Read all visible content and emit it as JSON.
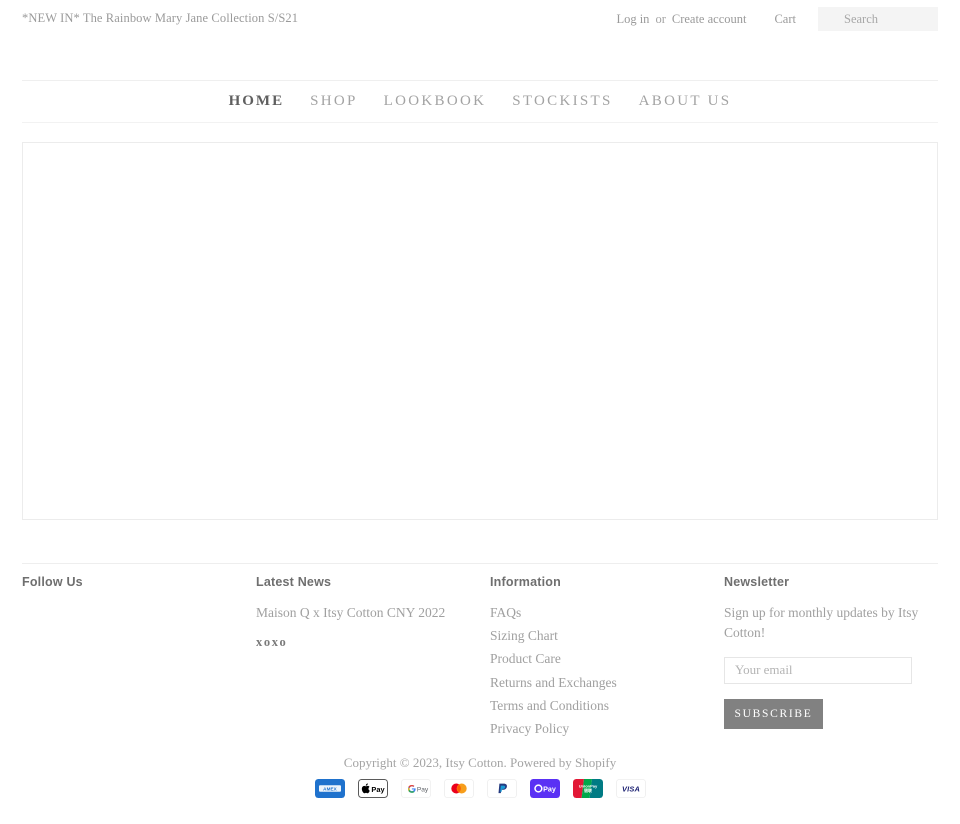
{
  "announcement": {
    "text": "*NEW IN* The Rainbow Mary Jane Collection S/S21"
  },
  "topbar": {
    "login_label": "Log in",
    "separator": "or",
    "create_account_label": "Create account",
    "cart_label": "Cart",
    "search_placeholder": "Search"
  },
  "nav": {
    "items": [
      {
        "label": "Home",
        "active": true
      },
      {
        "label": "Shop",
        "active": false
      },
      {
        "label": "Lookbook",
        "active": false
      },
      {
        "label": "Stockists",
        "active": false
      },
      {
        "label": "About Us",
        "active": false
      }
    ]
  },
  "footer": {
    "follow": {
      "title": "Follow Us"
    },
    "news": {
      "title": "Latest News",
      "article": "Maison Q x Itsy Cotton CNY 2022",
      "excerpt": "xoxo"
    },
    "information": {
      "title": "Information",
      "links": [
        "FAQs",
        "Sizing Chart",
        "Product Care",
        "Returns and Exchanges",
        "Terms and Conditions",
        "Privacy Policy"
      ]
    },
    "newsletter": {
      "title": "Newsletter",
      "description": "Sign up for monthly updates by Itsy Cotton!",
      "email_placeholder": "Your email",
      "subscribe_label": "Subscribe"
    },
    "copyright": "Copyright © 2023, Itsy Cotton. Powered by Shopify",
    "payment_methods": [
      "american-express",
      "apple-pay",
      "google-pay",
      "mastercard",
      "paypal",
      "shop-pay",
      "union-pay",
      "visa"
    ]
  },
  "colors": {
    "text_muted": "#a0a0a0",
    "text_dark": "#5f5f5f",
    "button": "#818181",
    "border": "#ececec",
    "search_bg": "#f4f4f4"
  }
}
